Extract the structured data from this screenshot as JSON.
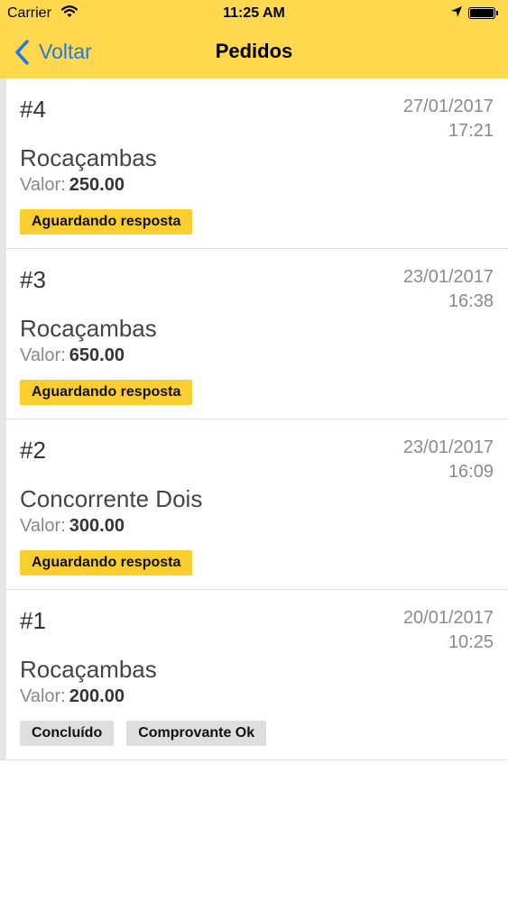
{
  "status_bar": {
    "carrier": "Carrier",
    "time": "11:25 AM"
  },
  "nav": {
    "back_label": "Voltar",
    "title": "Pedidos"
  },
  "labels": {
    "valor": "Valor:"
  },
  "colors": {
    "header": "#FFD84D",
    "accent": "#1E7AE6",
    "badge_waiting": "#F9CE2E",
    "badge_done": "#DEDEDE"
  },
  "orders": [
    {
      "number": "#4",
      "date": "27/01/2017",
      "time": "17:21",
      "company": "Rocaçambas",
      "value": "250.00",
      "badges": [
        "Aguardando resposta"
      ]
    },
    {
      "number": "#3",
      "date": "23/01/2017",
      "time": "16:38",
      "company": "Rocaçambas",
      "value": "650.00",
      "badges": [
        "Aguardando resposta"
      ]
    },
    {
      "number": "#2",
      "date": "23/01/2017",
      "time": "16:09",
      "company": "Concorrente Dois",
      "value": "300.00",
      "badges": [
        "Aguardando resposta"
      ]
    },
    {
      "number": "#1",
      "date": "20/01/2017",
      "time": "10:25",
      "company": "Rocaçambas",
      "value": "200.00",
      "badges": [
        "Concluído",
        "Comprovante Ok"
      ]
    }
  ]
}
